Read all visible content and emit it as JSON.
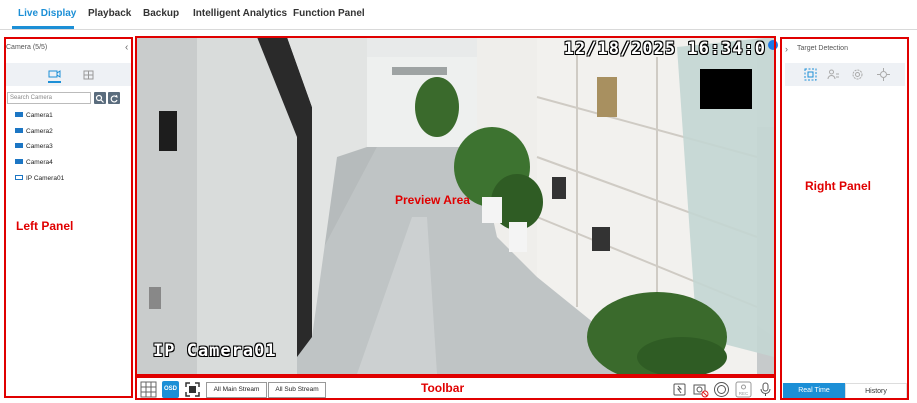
{
  "nav": {
    "tabs": [
      {
        "label": "Live Display",
        "active": true
      },
      {
        "label": "Playback",
        "active": false
      },
      {
        "label": "Backup",
        "active": false
      },
      {
        "label": "Intelligent Analytics",
        "active": false
      },
      {
        "label": "Function Panel",
        "active": false
      }
    ]
  },
  "left_panel": {
    "header": "Camera (5/5)",
    "search_placeholder": "Search Camera",
    "cameras": [
      {
        "label": "Camera1",
        "icon": "camera-icon"
      },
      {
        "label": "Camera2",
        "icon": "camera-icon"
      },
      {
        "label": "Camera3",
        "icon": "camera-icon"
      },
      {
        "label": "Camera4",
        "icon": "camera-icon"
      },
      {
        "label": "IP Camera01",
        "icon": "ip-camera-icon"
      }
    ]
  },
  "preview": {
    "osd_time": "12/18/2025  16:34:0",
    "osd_camera_name": "IP Camera01"
  },
  "toolbar": {
    "osd_label": "OSD",
    "main_stream_label": "All Main Stream",
    "sub_stream_label": "All Sub Stream"
  },
  "right_panel": {
    "title": "Target Detection",
    "tabs": [
      {
        "label": "Real Time",
        "active": true
      },
      {
        "label": "History",
        "active": false
      }
    ]
  },
  "annotations": {
    "left_panel": "Left Panel",
    "preview_area": "Preview Area",
    "right_panel": "Right Panel",
    "toolbar": "Toolbar"
  },
  "colors": {
    "accent": "#1c8fd6",
    "annotation_red": "#e00000"
  }
}
